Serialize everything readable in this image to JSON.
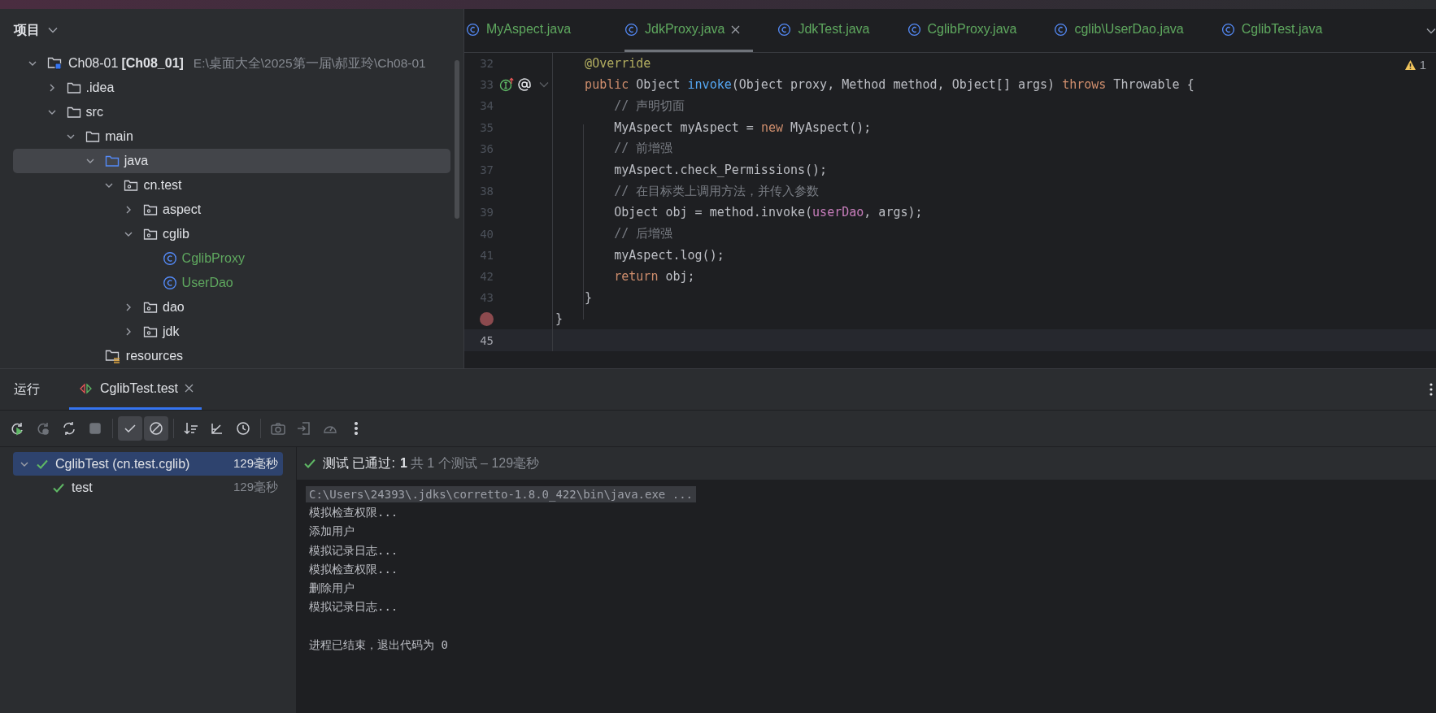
{
  "project_panel": {
    "title": "项目",
    "tree": [
      {
        "label": "Ch08-01",
        "module": "[Ch08_01]",
        "path": "E:\\桌面大全\\2025第一届\\郝亚玲\\Ch08-01",
        "kind": "module",
        "expanded": true,
        "selected": false,
        "children": [
          {
            "label": ".idea",
            "kind": "folder",
            "expanded": false,
            "selected": false
          },
          {
            "label": "src",
            "kind": "folder",
            "expanded": true,
            "selected": false,
            "children": [
              {
                "label": "main",
                "kind": "folder",
                "expanded": true,
                "selected": false,
                "children": [
                  {
                    "label": "java",
                    "kind": "source",
                    "expanded": true,
                    "selected": true,
                    "children": [
                      {
                        "label": "cn.test",
                        "kind": "package",
                        "expanded": true,
                        "selected": false,
                        "children": [
                          {
                            "label": "aspect",
                            "kind": "package",
                            "expanded": false,
                            "selected": false
                          },
                          {
                            "label": "cglib",
                            "kind": "package",
                            "expanded": true,
                            "selected": false,
                            "children": [
                              {
                                "label": "CglibProxy",
                                "kind": "class",
                                "selected": false
                              },
                              {
                                "label": "UserDao",
                                "kind": "class",
                                "selected": false
                              }
                            ]
                          },
                          {
                            "label": "dao",
                            "kind": "package",
                            "expanded": false,
                            "selected": false
                          },
                          {
                            "label": "jdk",
                            "kind": "package",
                            "expanded": false,
                            "selected": false
                          }
                        ]
                      }
                    ]
                  },
                  {
                    "label": "resources",
                    "kind": "resources",
                    "selected": false
                  }
                ]
              }
            ]
          }
        ]
      }
    ]
  },
  "editor": {
    "tabs": [
      {
        "label": "MyAspect.java",
        "selected": false
      },
      {
        "label": "JdkProxy.java",
        "selected": true
      },
      {
        "label": "JdkTest.java",
        "selected": false
      },
      {
        "label": "CglibProxy.java",
        "selected": false
      },
      {
        "label": "cglib\\UserDao.java",
        "selected": false
      },
      {
        "label": "CglibTest.java",
        "selected": false
      }
    ],
    "warnings": "1",
    "lines": [
      {
        "number": "32",
        "breakpoint": false,
        "current": false,
        "tokens": [
          {
            "text": "    @Override",
            "kind": "annotation"
          }
        ]
      },
      {
        "number": "33",
        "breakpoint": false,
        "current": false,
        "gutter_marks": true,
        "tokens": [
          {
            "text": "    public",
            "kind": "keyword"
          },
          {
            "text": " Object ",
            "kind": "plain"
          },
          {
            "text": "invoke",
            "kind": "method"
          },
          {
            "text": "(Object proxy, Method method, Object[] args) ",
            "kind": "plain"
          },
          {
            "text": "throws",
            "kind": "keyword"
          },
          {
            "text": " Throwable {",
            "kind": "plain"
          }
        ]
      },
      {
        "number": "34",
        "breakpoint": false,
        "current": false,
        "tokens": [
          {
            "text": "        // 声明切面",
            "kind": "comment"
          }
        ]
      },
      {
        "number": "35",
        "breakpoint": false,
        "current": false,
        "tokens": [
          {
            "text": "        MyAspect myAspect = ",
            "kind": "plain"
          },
          {
            "text": "new",
            "kind": "keyword"
          },
          {
            "text": " MyAspect();",
            "kind": "plain"
          }
        ]
      },
      {
        "number": "36",
        "breakpoint": false,
        "current": false,
        "tokens": [
          {
            "text": "        // 前增强",
            "kind": "comment"
          }
        ]
      },
      {
        "number": "37",
        "breakpoint": false,
        "current": false,
        "tokens": [
          {
            "text": "        myAspect.check_Permissions();",
            "kind": "plain"
          }
        ]
      },
      {
        "number": "38",
        "breakpoint": false,
        "current": false,
        "tokens": [
          {
            "text": "        // 在目标类上调用方法，并传入参数",
            "kind": "comment"
          }
        ]
      },
      {
        "number": "39",
        "breakpoint": false,
        "current": false,
        "tokens": [
          {
            "text": "        Object obj = method.invoke(",
            "kind": "plain"
          },
          {
            "text": "userDao",
            "kind": "field"
          },
          {
            "text": ", args);",
            "kind": "plain"
          }
        ]
      },
      {
        "number": "40",
        "breakpoint": false,
        "current": false,
        "tokens": [
          {
            "text": "        // 后增强",
            "kind": "comment"
          }
        ]
      },
      {
        "number": "41",
        "breakpoint": false,
        "current": false,
        "tokens": [
          {
            "text": "        myAspect.log();",
            "kind": "plain"
          }
        ]
      },
      {
        "number": "42",
        "breakpoint": false,
        "current": false,
        "tokens": [
          {
            "text": "        return",
            "kind": "keyword"
          },
          {
            "text": " obj;",
            "kind": "plain"
          }
        ]
      },
      {
        "number": "43",
        "breakpoint": false,
        "current": false,
        "tokens": [
          {
            "text": "    }",
            "kind": "plain"
          }
        ]
      },
      {
        "breakpoint": true,
        "current": false,
        "tokens": [
          {
            "text": "}",
            "kind": "plain"
          }
        ]
      },
      {
        "number": "45",
        "breakpoint": false,
        "current": true
      }
    ]
  },
  "run_panel": {
    "title": "运行",
    "tabs": [
      {
        "label": "CglibTest.test",
        "selected": true
      }
    ],
    "toolbar": [
      {
        "kind": "rerun",
        "disabled": false,
        "on": false
      },
      {
        "kind": "rerun-failed",
        "disabled": true,
        "on": false
      },
      {
        "kind": "toggle-auto",
        "disabled": false,
        "on": false
      },
      {
        "kind": "stop",
        "disabled": true,
        "on": false
      },
      {
        "kind": "show-passed",
        "disabled": false,
        "on": true
      },
      {
        "kind": "show-ignored",
        "disabled": false,
        "on": true
      },
      {
        "kind": "sort",
        "disabled": false,
        "on": false
      },
      {
        "kind": "collapse",
        "disabled": false,
        "on": false
      },
      {
        "kind": "history",
        "disabled": false,
        "on": false
      },
      {
        "kind": "camera",
        "disabled": true,
        "on": false
      },
      {
        "kind": "import",
        "disabled": true,
        "on": false
      },
      {
        "kind": "gauge",
        "disabled": true,
        "on": false
      },
      {
        "kind": "more",
        "disabled": false,
        "on": false
      }
    ],
    "tests": [
      {
        "label": "CglibTest (cn.test.cglib)",
        "time": "129毫秒",
        "passed": true,
        "selected": true,
        "expanded": true,
        "children": [
          {
            "label": "test",
            "time": "129毫秒",
            "passed": true,
            "selected": false
          }
        ]
      }
    ],
    "summary": {
      "status": "测试 已通过:",
      "count": "1",
      "detail": "共 1 个测试 – 129毫秒"
    },
    "console": [
      {
        "text": "C:\\Users\\24393\\.jdks\\corretto-1.8.0_422\\bin\\java.exe ...",
        "kind": "command"
      },
      {
        "text": "模拟检查权限...",
        "kind": "output"
      },
      {
        "text": "添加用户",
        "kind": "output"
      },
      {
        "text": "模拟记录日志...",
        "kind": "output"
      },
      {
        "text": "模拟检查权限...",
        "kind": "output"
      },
      {
        "text": "删除用户",
        "kind": "output"
      },
      {
        "text": "模拟记录日志...",
        "kind": "output"
      },
      {
        "kind": "blank"
      },
      {
        "text": "进程已结束，退出代码为 0",
        "kind": "output"
      }
    ]
  }
}
